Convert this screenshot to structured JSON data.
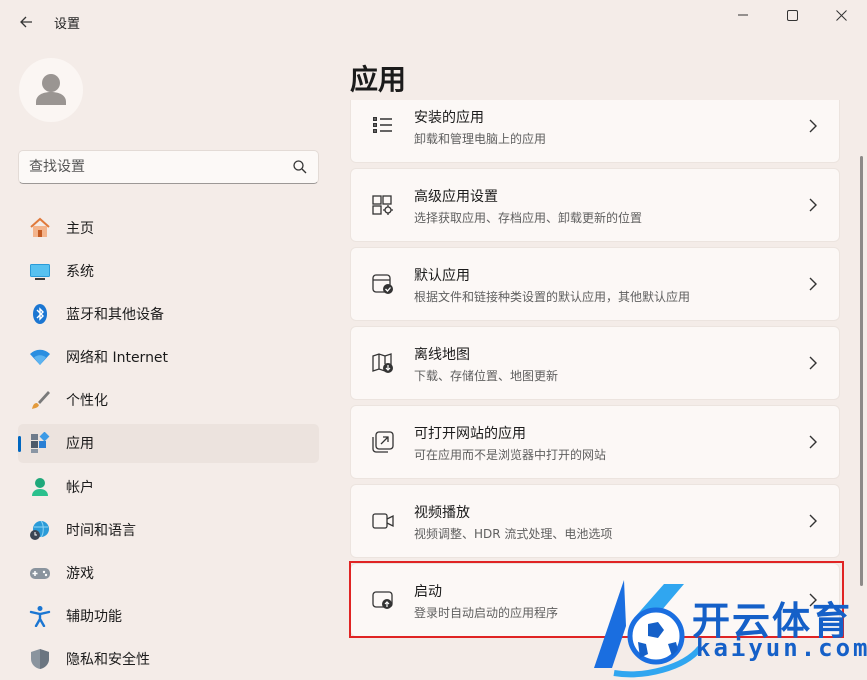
{
  "window": {
    "title": "设置",
    "back_icon": "arrow-left-icon",
    "controls": [
      "minimize-icon",
      "maximize-icon",
      "close-icon"
    ]
  },
  "search": {
    "placeholder": "查找设置",
    "value": ""
  },
  "sidebar": {
    "items": [
      {
        "label": "主页",
        "icon": "home-icon"
      },
      {
        "label": "系统",
        "icon": "monitor-icon"
      },
      {
        "label": "蓝牙和其他设备",
        "icon": "bluetooth-icon"
      },
      {
        "label": "网络和 Internet",
        "icon": "wifi-icon"
      },
      {
        "label": "个性化",
        "icon": "brush-icon"
      },
      {
        "label": "应用",
        "icon": "apps-icon",
        "selected": true
      },
      {
        "label": "帐户",
        "icon": "user-icon"
      },
      {
        "label": "时间和语言",
        "icon": "globe-clock-icon"
      },
      {
        "label": "游戏",
        "icon": "gamepad-icon"
      },
      {
        "label": "辅助功能",
        "icon": "accessibility-icon"
      },
      {
        "label": "隐私和安全性",
        "icon": "shield-icon"
      }
    ]
  },
  "main": {
    "title": "应用",
    "cards": [
      {
        "title": "安装的应用",
        "subtitle": "卸载和管理电脑上的应用",
        "icon": "list-icon"
      },
      {
        "title": "高级应用设置",
        "subtitle": "选择获取应用、存档应用、卸载更新的位置",
        "icon": "app-settings-icon"
      },
      {
        "title": "默认应用",
        "subtitle": "根据文件和链接种类设置的默认应用，其他默认应用",
        "icon": "default-apps-icon"
      },
      {
        "title": "离线地图",
        "subtitle": "下载、存储位置、地图更新",
        "icon": "map-icon"
      },
      {
        "title": "可打开网站的应用",
        "subtitle": "可在应用而不是浏览器中打开的网站",
        "icon": "open-link-icon"
      },
      {
        "title": "视频播放",
        "subtitle": "视频调整、HDR 流式处理、电池选项",
        "icon": "video-icon"
      },
      {
        "title": "启动",
        "subtitle": "登录时自动启动的应用程序",
        "icon": "startup-icon"
      }
    ]
  },
  "watermark": {
    "brand": "开云体育",
    "url": "kaiyun.com"
  },
  "colors": {
    "accent": "#0067c0",
    "highlight": "#e02424",
    "background": "#f4ece8",
    "watermark": "#1560c8"
  }
}
